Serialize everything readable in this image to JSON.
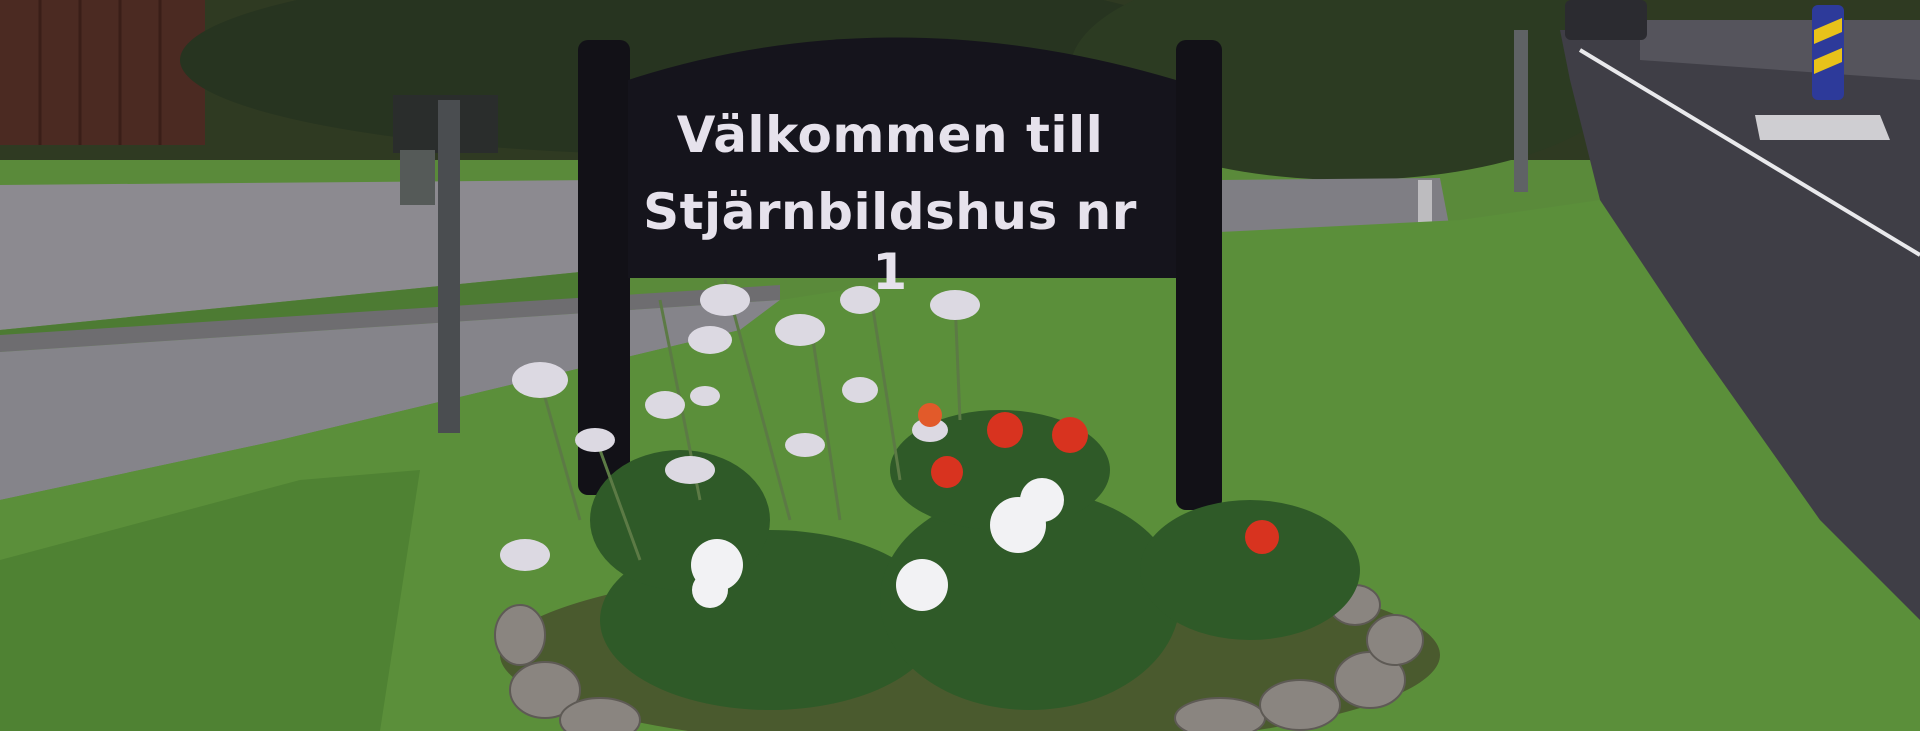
{
  "sign": {
    "line1": "Välkommen till",
    "line2": "Stjärnbildshus nr 1"
  },
  "colors": {
    "grass": "#5a8f3c",
    "asphalt": "#4a4a52",
    "sign_board": "#15141c",
    "sign_text": "#e6e2ec",
    "flower_red": "#d8331f",
    "flower_white": "#f2f2f4"
  }
}
